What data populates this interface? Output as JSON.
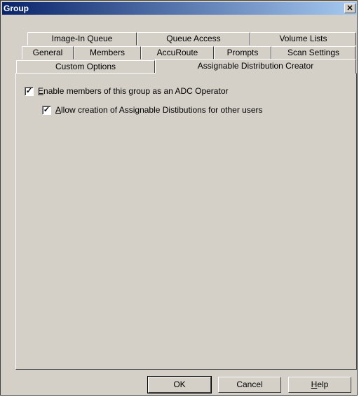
{
  "window": {
    "title": "Group",
    "close_glyph": "✕"
  },
  "tabs": {
    "row1": [
      "Image-In Queue",
      "Queue Access",
      "Volume Lists"
    ],
    "row2": [
      "General",
      "Members",
      "AccuRoute",
      "Prompts",
      "Scan Settings"
    ],
    "row3": [
      "Custom Options",
      "Assignable Distribution Creator"
    ]
  },
  "active_tab": "Assignable Distribution Creator",
  "options": {
    "enable_adc": {
      "checked": true,
      "label_mnemonic": "E",
      "label_rest": "nable members of this group as an ADC Operator"
    },
    "allow_creation": {
      "checked": true,
      "label_mnemonic": "A",
      "label_rest": "llow creation of Assignable Distibutions for other users"
    }
  },
  "buttons": {
    "ok": "OK",
    "cancel": "Cancel",
    "help_mnemonic": "H",
    "help_rest": "elp"
  }
}
